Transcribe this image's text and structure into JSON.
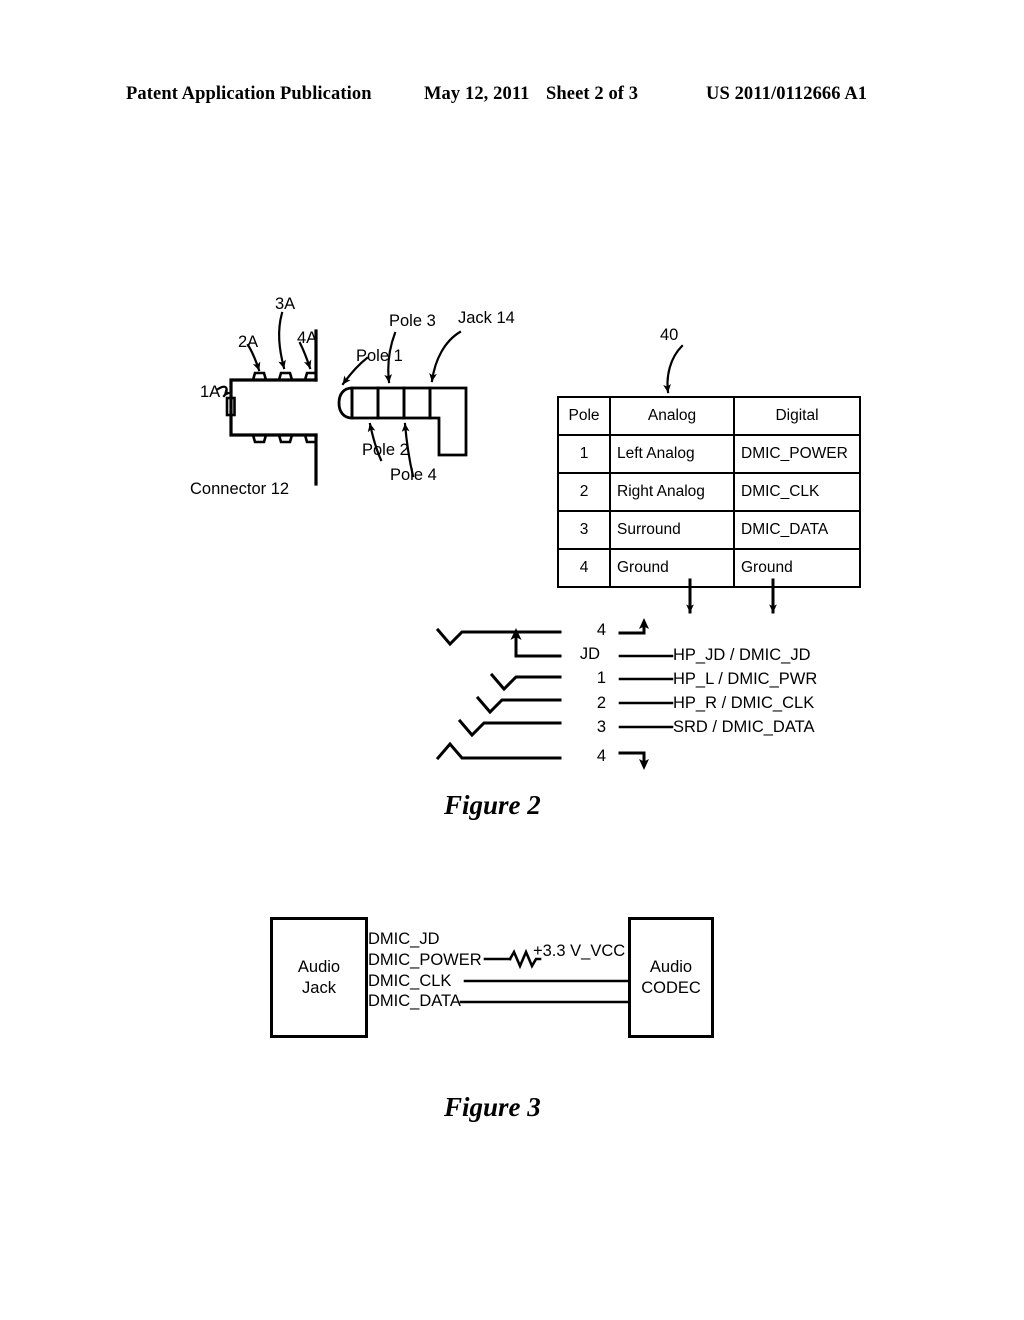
{
  "header": {
    "publication": "Patent Application Publication",
    "date": "May 12, 2011",
    "sheet": "Sheet 2 of 3",
    "patent_number": "US 2011/0112666 A1"
  },
  "figure2": {
    "caption": "Figure 2",
    "connector_label": "Connector 12",
    "contact_labels": {
      "c1": "1A",
      "c2": "2A",
      "c3": "3A",
      "c4": "4A"
    },
    "jack_label": "Jack 14",
    "pole_labels": {
      "p1": "Pole 1",
      "p2": "Pole 2",
      "p3": "Pole 3",
      "p4": "Pole 4"
    },
    "table_ref": "40",
    "table": {
      "columns": [
        "Pole",
        "Analog",
        "Digital"
      ],
      "rows": [
        {
          "pole": "1",
          "analog": "Left Analog",
          "digital": "DMIC_POWER"
        },
        {
          "pole": "2",
          "analog": "Right Analog",
          "digital": "DMIC_CLK"
        },
        {
          "pole": "3",
          "analog": "Surround",
          "digital": "DMIC_DATA"
        },
        {
          "pole": "4",
          "analog": "Ground",
          "digital": "Ground"
        }
      ]
    },
    "signals": [
      {
        "pin": "4",
        "name": ""
      },
      {
        "pin": "JD",
        "name": "HP_JD /  DMIC_JD"
      },
      {
        "pin": "1",
        "name": "HP_L / DMIC_PWR"
      },
      {
        "pin": "2",
        "name": "HP_R / DMIC_CLK"
      },
      {
        "pin": "3",
        "name": "SRD / DMIC_DATA"
      },
      {
        "pin": "4",
        "name": ""
      }
    ]
  },
  "figure3": {
    "caption": "Figure 3",
    "blocks": {
      "left": "Audio\nJack",
      "left_line1": "Audio",
      "left_line2": "Jack",
      "right_line1": "Audio",
      "right_line2": "CODEC"
    },
    "nets": {
      "jd": "DMIC_JD",
      "power": "DMIC_POWER",
      "clk": "DMIC_CLK",
      "data": "DMIC_DATA",
      "vcc": "+3.3 V_VCC"
    }
  },
  "colors": {
    "ink": "#000000",
    "paper": "#ffffff"
  }
}
